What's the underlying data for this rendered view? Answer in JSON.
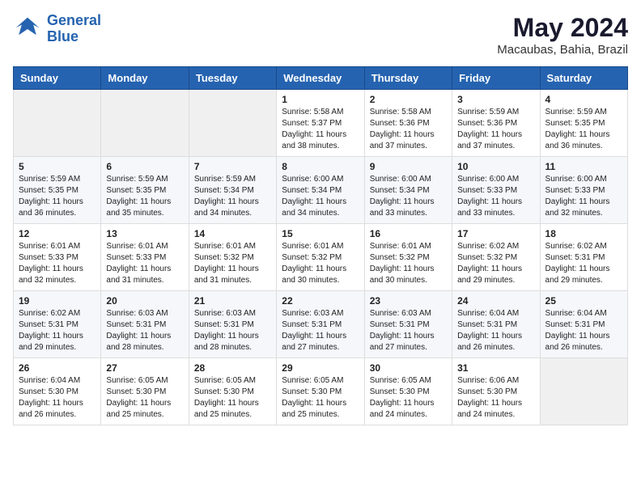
{
  "header": {
    "logo_line1": "General",
    "logo_line2": "Blue",
    "month": "May 2024",
    "location": "Macaubas, Bahia, Brazil"
  },
  "weekdays": [
    "Sunday",
    "Monday",
    "Tuesday",
    "Wednesday",
    "Thursday",
    "Friday",
    "Saturday"
  ],
  "weeks": [
    [
      {
        "day": "",
        "info": ""
      },
      {
        "day": "",
        "info": ""
      },
      {
        "day": "",
        "info": ""
      },
      {
        "day": "1",
        "info": "Sunrise: 5:58 AM\nSunset: 5:37 PM\nDaylight: 11 hours\nand 38 minutes."
      },
      {
        "day": "2",
        "info": "Sunrise: 5:58 AM\nSunset: 5:36 PM\nDaylight: 11 hours\nand 37 minutes."
      },
      {
        "day": "3",
        "info": "Sunrise: 5:59 AM\nSunset: 5:36 PM\nDaylight: 11 hours\nand 37 minutes."
      },
      {
        "day": "4",
        "info": "Sunrise: 5:59 AM\nSunset: 5:35 PM\nDaylight: 11 hours\nand 36 minutes."
      }
    ],
    [
      {
        "day": "5",
        "info": "Sunrise: 5:59 AM\nSunset: 5:35 PM\nDaylight: 11 hours\nand 36 minutes."
      },
      {
        "day": "6",
        "info": "Sunrise: 5:59 AM\nSunset: 5:35 PM\nDaylight: 11 hours\nand 35 minutes."
      },
      {
        "day": "7",
        "info": "Sunrise: 5:59 AM\nSunset: 5:34 PM\nDaylight: 11 hours\nand 34 minutes."
      },
      {
        "day": "8",
        "info": "Sunrise: 6:00 AM\nSunset: 5:34 PM\nDaylight: 11 hours\nand 34 minutes."
      },
      {
        "day": "9",
        "info": "Sunrise: 6:00 AM\nSunset: 5:34 PM\nDaylight: 11 hours\nand 33 minutes."
      },
      {
        "day": "10",
        "info": "Sunrise: 6:00 AM\nSunset: 5:33 PM\nDaylight: 11 hours\nand 33 minutes."
      },
      {
        "day": "11",
        "info": "Sunrise: 6:00 AM\nSunset: 5:33 PM\nDaylight: 11 hours\nand 32 minutes."
      }
    ],
    [
      {
        "day": "12",
        "info": "Sunrise: 6:01 AM\nSunset: 5:33 PM\nDaylight: 11 hours\nand 32 minutes."
      },
      {
        "day": "13",
        "info": "Sunrise: 6:01 AM\nSunset: 5:33 PM\nDaylight: 11 hours\nand 31 minutes."
      },
      {
        "day": "14",
        "info": "Sunrise: 6:01 AM\nSunset: 5:32 PM\nDaylight: 11 hours\nand 31 minutes."
      },
      {
        "day": "15",
        "info": "Sunrise: 6:01 AM\nSunset: 5:32 PM\nDaylight: 11 hours\nand 30 minutes."
      },
      {
        "day": "16",
        "info": "Sunrise: 6:01 AM\nSunset: 5:32 PM\nDaylight: 11 hours\nand 30 minutes."
      },
      {
        "day": "17",
        "info": "Sunrise: 6:02 AM\nSunset: 5:32 PM\nDaylight: 11 hours\nand 29 minutes."
      },
      {
        "day": "18",
        "info": "Sunrise: 6:02 AM\nSunset: 5:31 PM\nDaylight: 11 hours\nand 29 minutes."
      }
    ],
    [
      {
        "day": "19",
        "info": "Sunrise: 6:02 AM\nSunset: 5:31 PM\nDaylight: 11 hours\nand 29 minutes."
      },
      {
        "day": "20",
        "info": "Sunrise: 6:03 AM\nSunset: 5:31 PM\nDaylight: 11 hours\nand 28 minutes."
      },
      {
        "day": "21",
        "info": "Sunrise: 6:03 AM\nSunset: 5:31 PM\nDaylight: 11 hours\nand 28 minutes."
      },
      {
        "day": "22",
        "info": "Sunrise: 6:03 AM\nSunset: 5:31 PM\nDaylight: 11 hours\nand 27 minutes."
      },
      {
        "day": "23",
        "info": "Sunrise: 6:03 AM\nSunset: 5:31 PM\nDaylight: 11 hours\nand 27 minutes."
      },
      {
        "day": "24",
        "info": "Sunrise: 6:04 AM\nSunset: 5:31 PM\nDaylight: 11 hours\nand 26 minutes."
      },
      {
        "day": "25",
        "info": "Sunrise: 6:04 AM\nSunset: 5:31 PM\nDaylight: 11 hours\nand 26 minutes."
      }
    ],
    [
      {
        "day": "26",
        "info": "Sunrise: 6:04 AM\nSunset: 5:30 PM\nDaylight: 11 hours\nand 26 minutes."
      },
      {
        "day": "27",
        "info": "Sunrise: 6:05 AM\nSunset: 5:30 PM\nDaylight: 11 hours\nand 25 minutes."
      },
      {
        "day": "28",
        "info": "Sunrise: 6:05 AM\nSunset: 5:30 PM\nDaylight: 11 hours\nand 25 minutes."
      },
      {
        "day": "29",
        "info": "Sunrise: 6:05 AM\nSunset: 5:30 PM\nDaylight: 11 hours\nand 25 minutes."
      },
      {
        "day": "30",
        "info": "Sunrise: 6:05 AM\nSunset: 5:30 PM\nDaylight: 11 hours\nand 24 minutes."
      },
      {
        "day": "31",
        "info": "Sunrise: 6:06 AM\nSunset: 5:30 PM\nDaylight: 11 hours\nand 24 minutes."
      },
      {
        "day": "",
        "info": ""
      }
    ]
  ]
}
